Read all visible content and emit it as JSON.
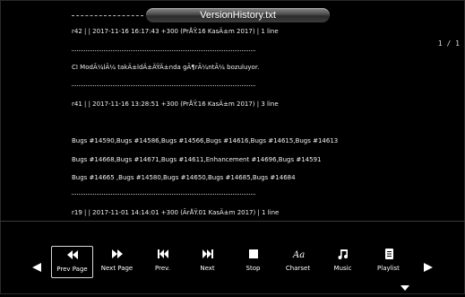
{
  "title": "VersionHistory.txt",
  "page_indicator": "1 / 1",
  "lines": [
    "r42 | | 2017-11-16 16:17:43 +300 (PrÅŸ.16 KasÄ±m 2017) | 1 line",
    "CI ModÃ¼lÃ¼ takÄ±ldÄ±ÄŸÄ±nda gÃ¶rÃ¼ntÃ¼ bozuluyor.",
    "r41 | | 2017-11-16 13:28:51 +300 (PrÅŸ.16 KasÄ±m 2017) | 3 line",
    "Bugs #14590,Bugs #14586,Bugs #14566,Bugs #14616,Bugs #14615,Bugs #14613",
    "Bugs #14668,Bugs #14671,Bugs #14611,Enhancement #14696,Bugs #14591",
    "Bugs #14665 ,Bugs #14580,Bugs #14650,Bugs #14685,Bugs #14684",
    "r19 | | 2017-11-01 14:14:01 +300 (ÃrÅŸ.01 KasÄ±m 2017) | 1 line"
  ],
  "toolbar": {
    "prev_page": "Prev Page",
    "next_page": "Next Page",
    "prev": "Prev.",
    "next": "Next",
    "stop": "Stop",
    "charset": "Charset",
    "music": "Music",
    "playlist": "Playlist"
  }
}
